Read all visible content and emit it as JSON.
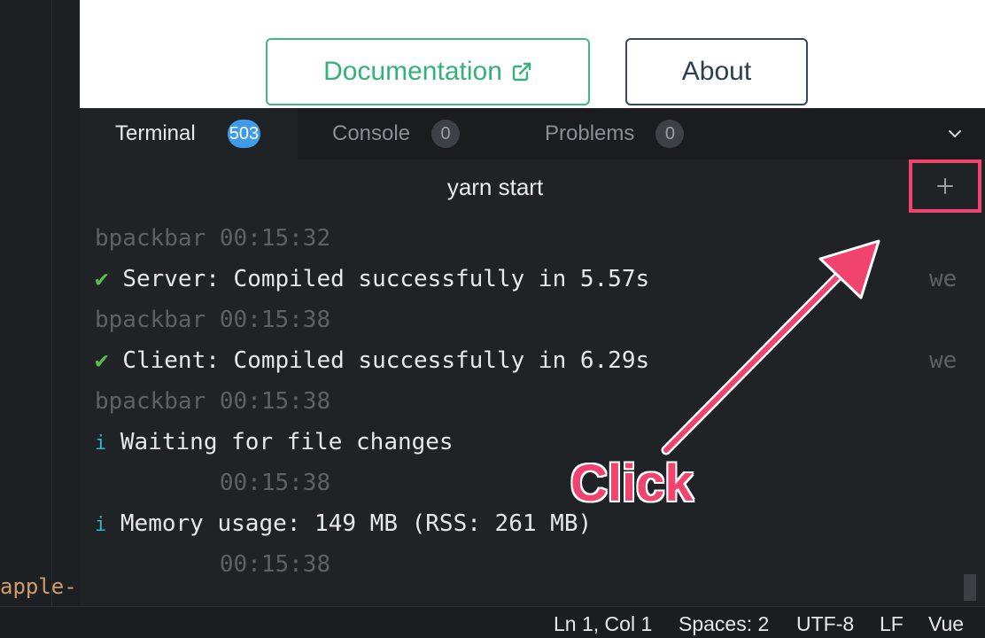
{
  "editor": {
    "code_fragment": "apple-"
  },
  "preview": {
    "documentation_label": "Documentation",
    "about_label": "About"
  },
  "panel": {
    "tabs": [
      {
        "label": "Terminal",
        "badge": "503",
        "active": true
      },
      {
        "label": "Console",
        "badge": "0",
        "active": false
      },
      {
        "label": "Problems",
        "badge": "0",
        "active": false
      }
    ],
    "terminal_title": "yarn start",
    "output": [
      {
        "text": "bpackbar 00:15:32"
      },
      {
        "icon": "✔",
        "text": "Server: Compiled successfully in 5.57s",
        "trail": "we"
      },
      {
        "text": "bpackbar 00:15:38"
      },
      {
        "icon": "✔",
        "text": "Client: Compiled successfully in 6.29s",
        "trail": "we"
      },
      {
        "text": "bpackbar 00:15:38"
      },
      {
        "icon": "i",
        "text": "Waiting for file changes"
      },
      {
        "text": "         00:15:38"
      },
      {
        "icon": "i",
        "text": "Memory usage: 149 MB (RSS: 261 MB)"
      },
      {
        "text": "         00:15:38"
      }
    ]
  },
  "status_bar": {
    "position": "Ln 1, Col 1",
    "spaces": "Spaces: 2",
    "encoding": "UTF-8",
    "eol": "LF",
    "language": "Vue"
  },
  "annotation": {
    "label": "Click"
  },
  "colors": {
    "accent_green": "#41b883",
    "about_border": "#34495e",
    "badge_blue": "#3d9be9",
    "annotation_pink": "#f0446f"
  }
}
